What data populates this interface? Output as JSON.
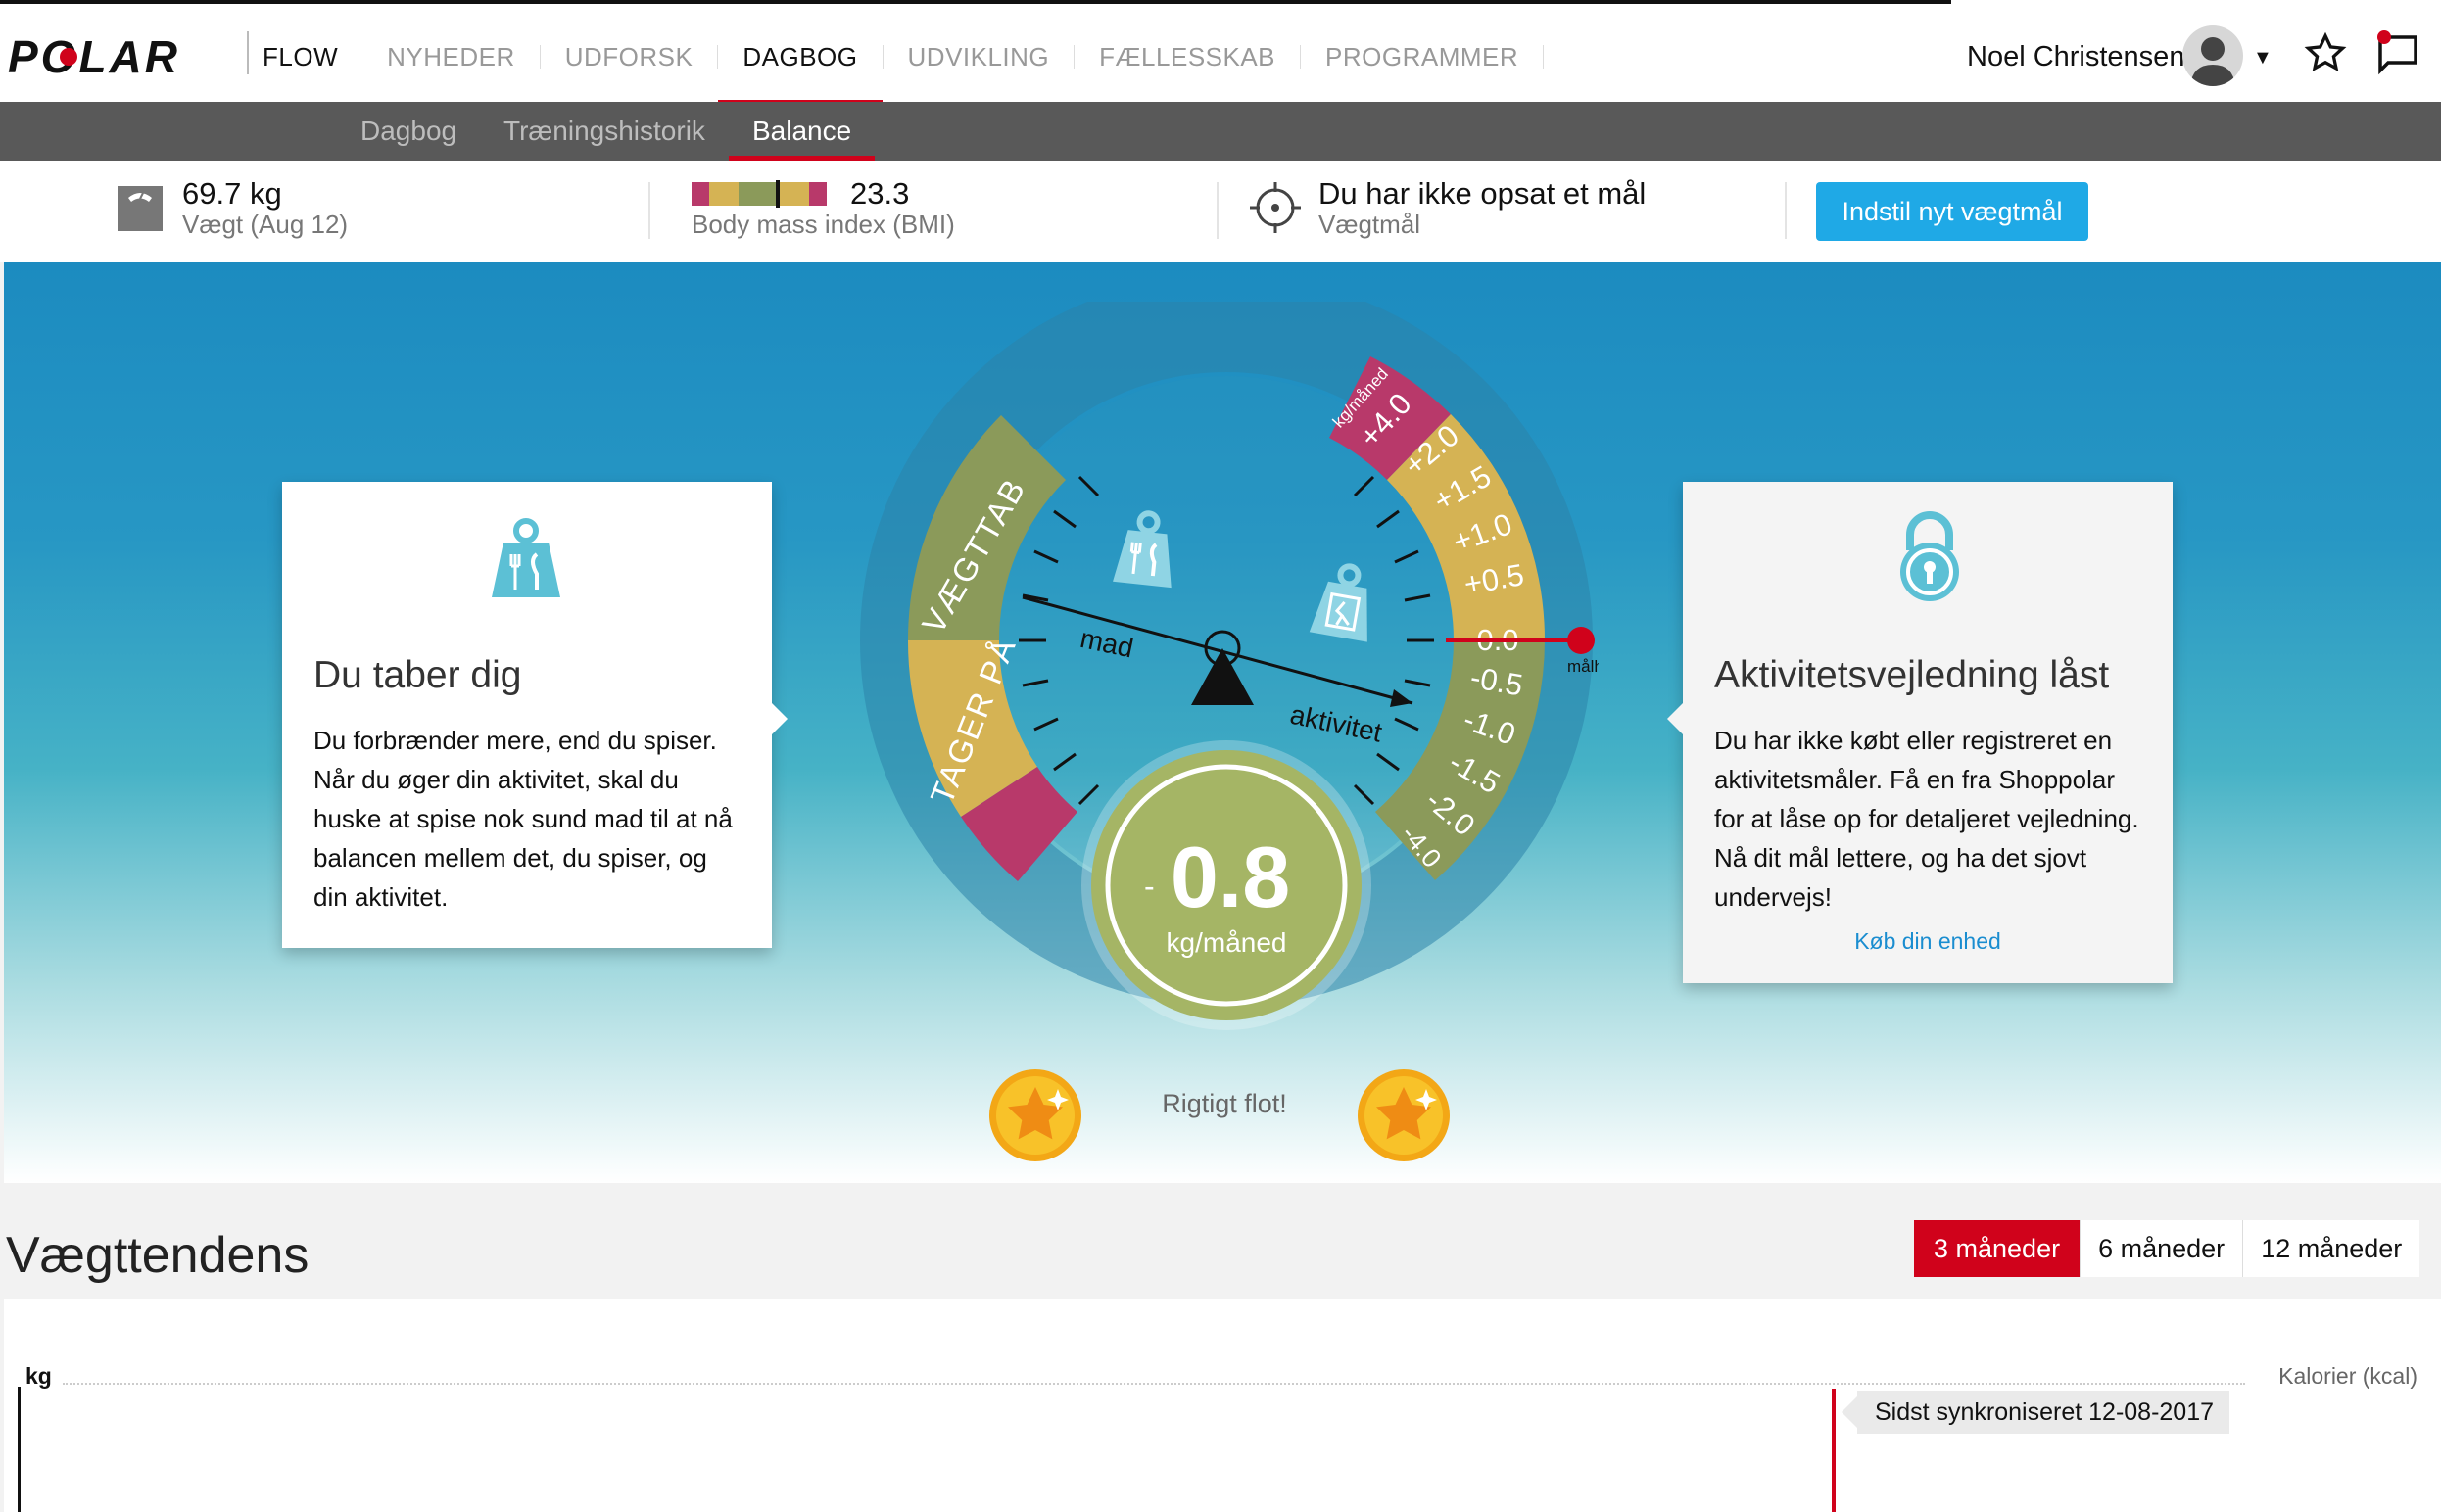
{
  "header": {
    "logo": "POLAR",
    "brand": "FLOW",
    "nav": [
      "NYHEDER",
      "UDFORSK",
      "DAGBOG",
      "UDVIKLING",
      "FÆLLESSKAB",
      "PROGRAMMER"
    ],
    "active_nav": "DAGBOG",
    "user_name": "Noel Christensen",
    "icons": [
      "avatar",
      "chevron-down-icon",
      "star-icon",
      "message-icon"
    ],
    "accent_color": "#d0021b"
  },
  "subnav": {
    "items": [
      "Dagbog",
      "Træningshistorik",
      "Balance"
    ],
    "active": "Balance"
  },
  "stats": {
    "weight": {
      "value": "69.7 kg",
      "label": "Vægt (Aug 12)"
    },
    "bmi": {
      "value": "23.3",
      "label": "Body mass index (BMI)"
    },
    "goal": {
      "value": "Du har ikke opsat et mål",
      "label": "Vægtmål"
    },
    "cta": "Indstil nyt vægtmål",
    "cta_color": "#1fa9e6"
  },
  "left_card": {
    "title": "Du taber dig",
    "text": "Du forbrænder mere, end du spiser. Når du øger din aktivitet, skal du huske at spise nok sund mad til at nå balancen mellem det, du spiser, og din aktivitet."
  },
  "right_card": {
    "title": "Aktivitetsvejledning låst",
    "text": "Du har ikke købt eller registreret en aktivitetsmåler. Få en fra Shoppolar for at låse op for detaljeret vejledning. Nå dit mål lettere, og ha det sjovt undervejs!",
    "link": "Køb din enhed"
  },
  "gauge": {
    "left_upper_label": "VÆGTTAB",
    "left_lower_label": "TAGER PÅ",
    "unit_arc": "kg/måned",
    "scale": [
      "+4.0",
      "+2.0",
      "+1.5",
      "+1.0",
      "+0.5",
      "0.0",
      "-0.5",
      "-1.0",
      "-1.5",
      "-2.0",
      "-4.0"
    ],
    "lever_left": "mad",
    "lever_right": "aktivitet",
    "target_label": "målhastighed",
    "value_sign": "-",
    "value": "0.8",
    "unit": "kg/måned",
    "colors": {
      "green": "#8b9a5a",
      "yellow": "#d5b354",
      "pink": "#b8396a"
    }
  },
  "praise": "Rigtigt flot!",
  "trend": {
    "title": "Vægttendens",
    "ranges": [
      "3 måneder",
      "6 måneder",
      "12 måneder"
    ],
    "active_range": "3 måneder",
    "y_left": "kg",
    "y_right": "Kalorier (kcal)",
    "sync": "Sidst synkroniseret 12-08-2017"
  }
}
